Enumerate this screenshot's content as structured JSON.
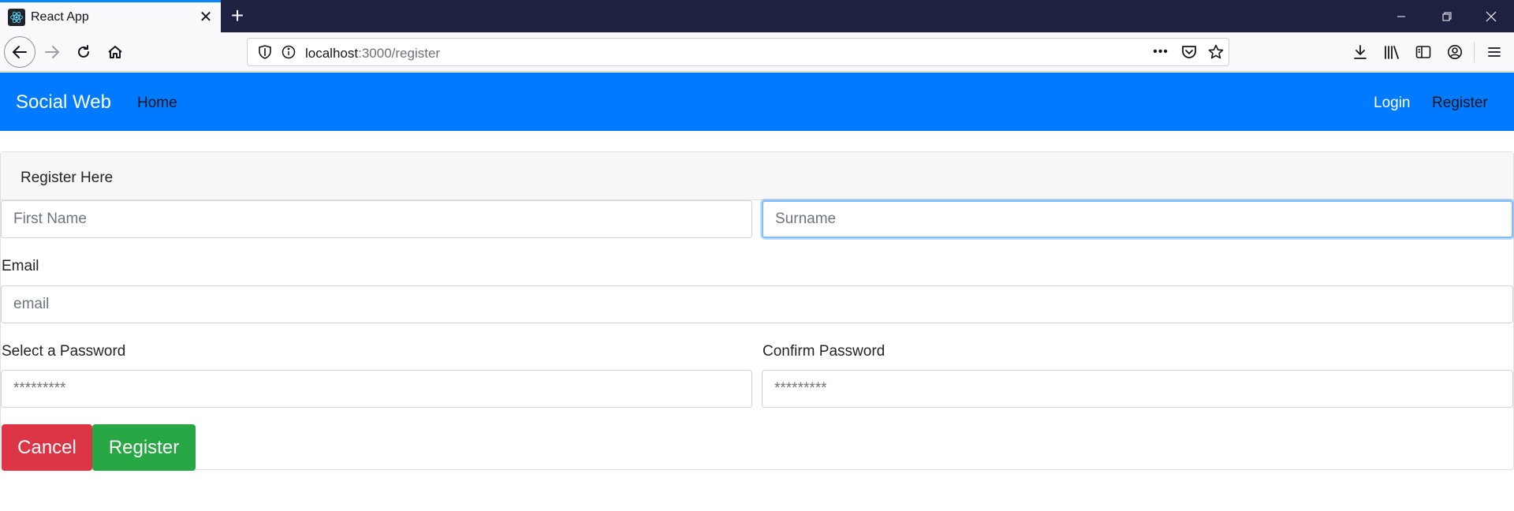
{
  "browser": {
    "tab_title": "React App",
    "tab_close": "✕",
    "new_tab": "+",
    "url_host": "localhost",
    "url_rest": ":3000/register",
    "page_actions": "•••"
  },
  "app_nav": {
    "brand": "Social Web",
    "home": "Home",
    "login": "Login",
    "register": "Register"
  },
  "form": {
    "header": "Register Here",
    "first_name_placeholder": "First Name",
    "surname_placeholder": "Surname",
    "email_label": "Email",
    "email_placeholder": "email",
    "password_label": "Select a Password",
    "password_placeholder": "*********",
    "confirm_label": "Confirm Password",
    "confirm_placeholder": "*********",
    "cancel_label": "Cancel",
    "register_label": "Register"
  },
  "colors": {
    "primary": "#007bff",
    "danger": "#dc3545",
    "success": "#28a745",
    "tabbar": "#1f2140"
  }
}
